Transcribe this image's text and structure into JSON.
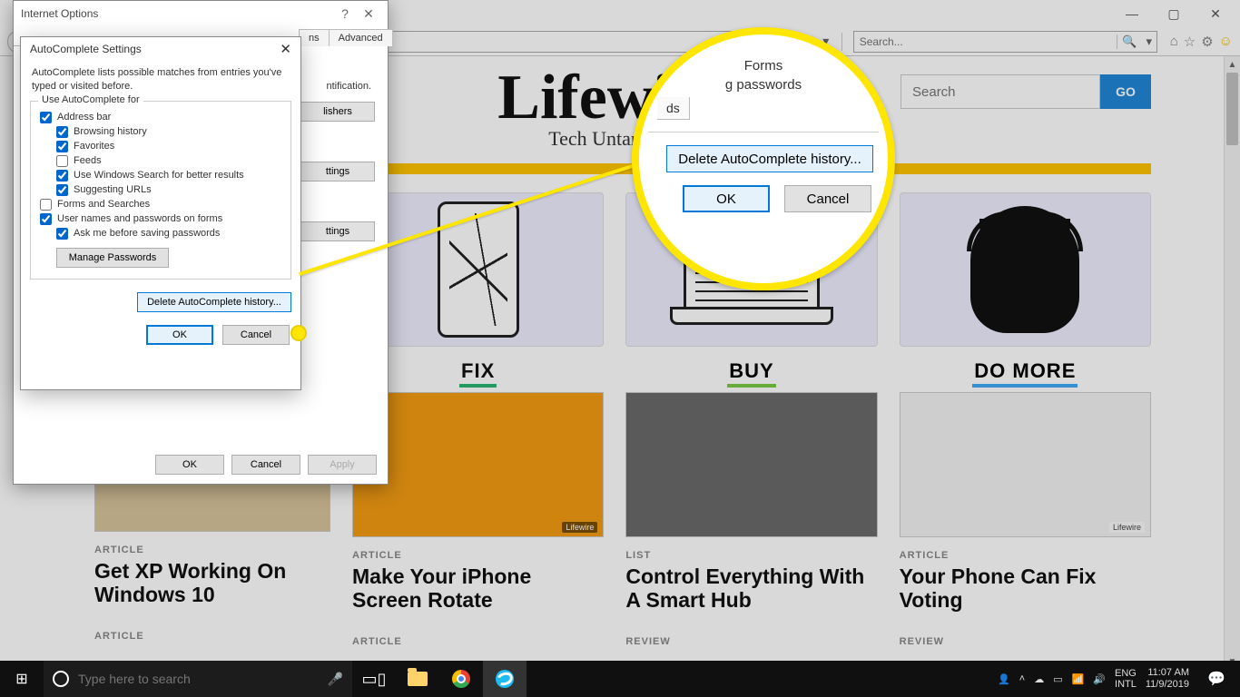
{
  "ie": {
    "minimize": "—",
    "maximize": "▢",
    "close": "✕",
    "back": "◀",
    "forward": "▶",
    "search_placeholder": "Search...",
    "lock": "🔒",
    "toolbar": {
      "home": "⌂",
      "star": "☆",
      "gear": "⚙",
      "smiley": "☺"
    }
  },
  "lifewire": {
    "brand": "Lifewire",
    "tag": "Tech Untangled",
    "search_placeholder": "Search",
    "go": "GO",
    "cols": [
      {
        "cat": "FIX",
        "tag1": "ARTICLE",
        "title1": "Get XP Working On Windows 10",
        "tag2": "ARTICLE",
        "card_badge": "Lifewire",
        "subtitle": "Make Your iPhone Screen Rotate",
        "subtag": "ARTICLE"
      },
      {
        "cat": "BUY",
        "tag1": "LIST",
        "title1": "Control Everything With A Smart Hub",
        "tag2": "REVIEW",
        "card_badge": ""
      },
      {
        "cat": "DO MORE",
        "tag1": "ARTICLE",
        "title1": "Your Phone Can Fix Voting",
        "tag2": "REVIEW",
        "card_badge": "Lifewire"
      }
    ],
    "left_hidden": {
      "tag": "ARTICLE",
      "title": "Get XP Working On Windows 10",
      "tag2": "ARTICLE"
    }
  },
  "dlg_io": {
    "title": "Internet Options",
    "help": "?",
    "close": "✕",
    "tabs_visible": [
      "ns",
      "Advanced"
    ],
    "body_frag1": "ntification.",
    "btn_pub": "lishers",
    "btn_set1": "ttings",
    "btn_set2": "ttings",
    "ok": "OK",
    "cancel": "Cancel",
    "apply": "Apply"
  },
  "dlg_ac": {
    "title": "AutoComplete Settings",
    "close": "✕",
    "desc": "AutoComplete lists possible matches from entries you've typed or visited before.",
    "legend": "Use AutoComplete for",
    "items": {
      "address_bar": "Address bar",
      "browsing": "Browsing history",
      "favorites": "Favorites",
      "feeds": "Feeds",
      "win_search": "Use Windows Search for better results",
      "suggest": "Suggesting URLs",
      "forms": "Forms and Searches",
      "userpw": "User names and passwords on forms",
      "ask": "Ask me before saving passwords"
    },
    "manage": "Manage Passwords",
    "delete": "Delete AutoComplete history...",
    "ok": "OK",
    "cancel": "Cancel"
  },
  "callout": {
    "frag_forms": "Forms",
    "frag_pw": "g passwords",
    "frag_ds": "ds",
    "delete": "Delete AutoComplete history...",
    "ok": "OK",
    "cancel": "Cancel"
  },
  "taskbar": {
    "search_placeholder": "Type here to search",
    "tray": {
      "lang": "ENG",
      "intl": "INTL",
      "time": "11:07 AM",
      "date": "11/9/2019"
    }
  }
}
